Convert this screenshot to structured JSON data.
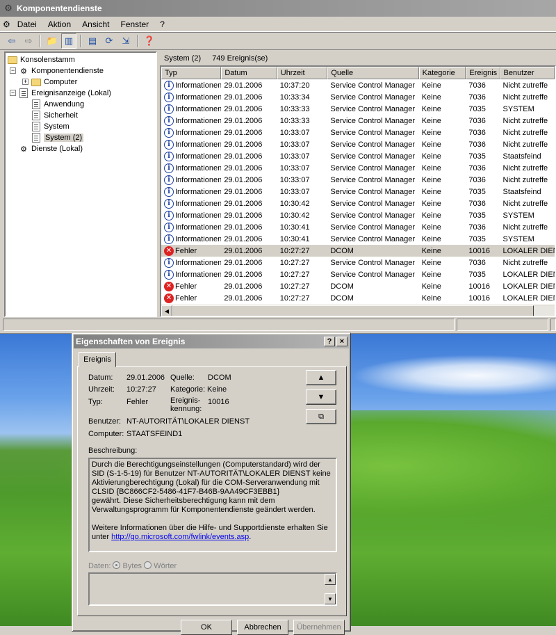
{
  "window": {
    "title": "Komponentendienste"
  },
  "menu": [
    "Datei",
    "Aktion",
    "Ansicht",
    "Fenster",
    "?"
  ],
  "tree": {
    "root": "Konsolenstamm",
    "components": "Komponentendienste",
    "computer": "Computer",
    "eventviewer": "Ereignisanzeige (Lokal)",
    "app": "Anwendung",
    "security": "Sicherheit",
    "system": "System",
    "system2": "System (2)",
    "services": "Dienste (Lokal)"
  },
  "list": {
    "title": "System (2)",
    "count": "749 Ereignis(se)",
    "columns": [
      "Typ",
      "Datum",
      "Uhrzeit",
      "Quelle",
      "Kategorie",
      "Ereignis",
      "Benutzer"
    ],
    "rows": [
      {
        "type": "Informationen",
        "date": "29.01.2006",
        "time": "10:37:20",
        "source": "Service Control Manager",
        "cat": "Keine",
        "event": "7036",
        "user": "Nicht zutreffe"
      },
      {
        "type": "Informationen",
        "date": "29.01.2006",
        "time": "10:33:34",
        "source": "Service Control Manager",
        "cat": "Keine",
        "event": "7036",
        "user": "Nicht zutreffe"
      },
      {
        "type": "Informationen",
        "date": "29.01.2006",
        "time": "10:33:33",
        "source": "Service Control Manager",
        "cat": "Keine",
        "event": "7035",
        "user": "SYSTEM"
      },
      {
        "type": "Informationen",
        "date": "29.01.2006",
        "time": "10:33:33",
        "source": "Service Control Manager",
        "cat": "Keine",
        "event": "7036",
        "user": "Nicht zutreffe"
      },
      {
        "type": "Informationen",
        "date": "29.01.2006",
        "time": "10:33:07",
        "source": "Service Control Manager",
        "cat": "Keine",
        "event": "7036",
        "user": "Nicht zutreffe"
      },
      {
        "type": "Informationen",
        "date": "29.01.2006",
        "time": "10:33:07",
        "source": "Service Control Manager",
        "cat": "Keine",
        "event": "7036",
        "user": "Nicht zutreffe"
      },
      {
        "type": "Informationen",
        "date": "29.01.2006",
        "time": "10:33:07",
        "source": "Service Control Manager",
        "cat": "Keine",
        "event": "7035",
        "user": "Staatsfeind"
      },
      {
        "type": "Informationen",
        "date": "29.01.2006",
        "time": "10:33:07",
        "source": "Service Control Manager",
        "cat": "Keine",
        "event": "7036",
        "user": "Nicht zutreffe"
      },
      {
        "type": "Informationen",
        "date": "29.01.2006",
        "time": "10:33:07",
        "source": "Service Control Manager",
        "cat": "Keine",
        "event": "7036",
        "user": "Nicht zutreffe"
      },
      {
        "type": "Informationen",
        "date": "29.01.2006",
        "time": "10:33:07",
        "source": "Service Control Manager",
        "cat": "Keine",
        "event": "7035",
        "user": "Staatsfeind"
      },
      {
        "type": "Informationen",
        "date": "29.01.2006",
        "time": "10:30:42",
        "source": "Service Control Manager",
        "cat": "Keine",
        "event": "7036",
        "user": "Nicht zutreffe"
      },
      {
        "type": "Informationen",
        "date": "29.01.2006",
        "time": "10:30:42",
        "source": "Service Control Manager",
        "cat": "Keine",
        "event": "7035",
        "user": "SYSTEM"
      },
      {
        "type": "Informationen",
        "date": "29.01.2006",
        "time": "10:30:41",
        "source": "Service Control Manager",
        "cat": "Keine",
        "event": "7036",
        "user": "Nicht zutreffe"
      },
      {
        "type": "Informationen",
        "date": "29.01.2006",
        "time": "10:30:41",
        "source": "Service Control Manager",
        "cat": "Keine",
        "event": "7035",
        "user": "SYSTEM"
      },
      {
        "type": "Fehler",
        "date": "29.01.2006",
        "time": "10:27:27",
        "source": "DCOM",
        "cat": "Keine",
        "event": "10016",
        "user": "LOKALER DIENS",
        "selected": true
      },
      {
        "type": "Informationen",
        "date": "29.01.2006",
        "time": "10:27:27",
        "source": "Service Control Manager",
        "cat": "Keine",
        "event": "7036",
        "user": "Nicht zutreffe"
      },
      {
        "type": "Informationen",
        "date": "29.01.2006",
        "time": "10:27:27",
        "source": "Service Control Manager",
        "cat": "Keine",
        "event": "7035",
        "user": "LOKALER DIEN"
      },
      {
        "type": "Fehler",
        "date": "29.01.2006",
        "time": "10:27:27",
        "source": "DCOM",
        "cat": "Keine",
        "event": "10016",
        "user": "LOKALER DIEN"
      },
      {
        "type": "Fehler",
        "date": "29.01.2006",
        "time": "10:27:27",
        "source": "DCOM",
        "cat": "Keine",
        "event": "10016",
        "user": "LOKALER DIEN"
      }
    ]
  },
  "dialog": {
    "title": "Eigenschaften von Ereignis",
    "help": "?",
    "close": "×",
    "tab": "Ereignis",
    "labels": {
      "date": "Datum:",
      "time": "Uhrzeit:",
      "type": "Typ:",
      "source": "Quelle:",
      "category": "Kategorie:",
      "eventid": "Ereignis-\nkennung:",
      "user": "Benutzer:",
      "computer": "Computer:",
      "description": "Beschreibung:",
      "data": "Daten:",
      "bytes": "Bytes",
      "words": "Wörter"
    },
    "values": {
      "date": "29.01.2006",
      "time": "10:27:27",
      "type": "Fehler",
      "source": "DCOM",
      "category": "Keine",
      "eventid": "10016",
      "user": "NT-AUTORITÄT\\LOKALER DIENST",
      "computer": "STAATSFEIND1"
    },
    "description": {
      "line1": "Durch die Berechtigungseinstellungen (Computerstandard) wird der SID (S-1-5-19) für Benutzer NT-AUTORITÄT\\LOKALER DIENST keine Aktivierungberechtigung (Lokal) für die COM-Serveranwendung mit CLSID {BC866CF2-5486-41F7-B46B-9AA49CF3EBB1}",
      "line2": " gewährt. Diese Sicherheitsberechtigung kann mit dem Verwaltungsprogramm für Komponentendienste geändert werden.",
      "line3": "Weitere Informationen über die Hilfe- und Supportdienste erhalten Sie unter",
      "link": "http://go.microsoft.com/fwlink/events.asp",
      "tail": "."
    },
    "buttons": {
      "ok": "OK",
      "cancel": "Abbrechen",
      "apply": "Übernehmen"
    }
  }
}
